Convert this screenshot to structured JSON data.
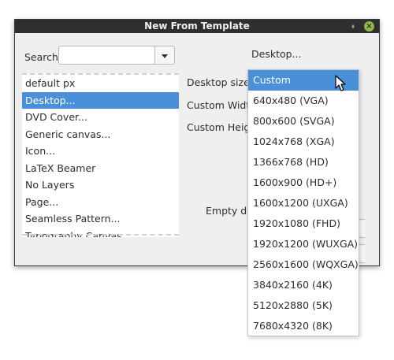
{
  "window": {
    "title": "New From Template",
    "pin_icon": "pin-icon",
    "close_icon": "close-icon"
  },
  "search": {
    "label": "Search:",
    "value": "",
    "placeholder": ""
  },
  "templates": {
    "items": [
      {
        "label": "default px",
        "selected": false
      },
      {
        "label": "Desktop...",
        "selected": true
      },
      {
        "label": "DVD Cover...",
        "selected": false
      },
      {
        "label": "Generic canvas...",
        "selected": false
      },
      {
        "label": "Icon...",
        "selected": false
      },
      {
        "label": "LaTeX Beamer",
        "selected": false
      },
      {
        "label": "No Layers",
        "selected": false
      },
      {
        "label": "Page...",
        "selected": false
      },
      {
        "label": "Seamless Pattern...",
        "selected": false
      },
      {
        "label": "Typography Canvas",
        "selected": false
      }
    ]
  },
  "details": {
    "title": "Desktop...",
    "desktop_size_label": "Desktop size:",
    "custom_width_label": "Custom Width",
    "custom_height_label": "Custom Heigh",
    "empty_label": "Empty de"
  },
  "size_dropdown": {
    "selected": "Custom",
    "options": [
      "Custom",
      "640x480 (VGA)",
      "800x600 (SVGA)",
      "1024x768 (XGA)",
      "1366x768 (HD)",
      "1600x900 (HD+)",
      "1600x1200 (UXGA)",
      "1920x1080 (FHD)",
      "1920x1200 (WUXGA)",
      "2560x1600 (WQXGA)",
      "3840x2160 (4K)",
      "5120x2880 (5K)",
      "7680x4320 (8K)"
    ]
  },
  "colors": {
    "accent": "#4a90d9",
    "titlebar": "#2f2f2f",
    "close": "#8dbb4a"
  }
}
